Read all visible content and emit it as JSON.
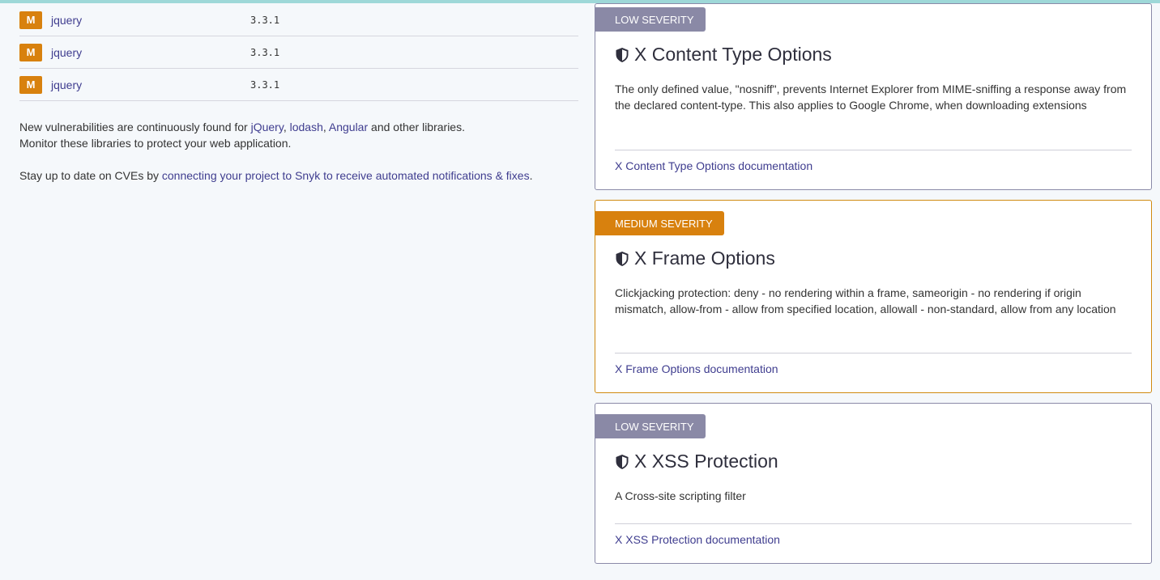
{
  "dependencies": [
    {
      "badge": "M",
      "name": "jquery",
      "version": "3.3.1"
    },
    {
      "badge": "M",
      "name": "jquery",
      "version": "3.3.1"
    },
    {
      "badge": "M",
      "name": "jquery",
      "version": "3.3.1"
    }
  ],
  "info": {
    "line1_prefix": "New vulnerabilities are continuously found for ",
    "link_jquery": "jQuery",
    "sep1": ", ",
    "link_lodash": "lodash",
    "sep2": ", ",
    "link_angular": "Angular",
    "line1_suffix": " and other libraries.",
    "line2": "Monitor these libraries to protect your web application.",
    "line3_prefix": "Stay up to date on CVEs by ",
    "line3_link": "connecting your project to Snyk to receive automated notifications & fixes",
    "line3_suffix": "."
  },
  "headers": [
    {
      "severity": "LOW SEVERITY",
      "title": "X Content Type Options",
      "description": "The only defined value, \"nosniff\", prevents Internet Explorer from MIME-sniffing a response away from the declared content-type. This also applies to Google Chrome, when downloading extensions",
      "doc_link": "X Content Type Options documentation"
    },
    {
      "severity": "MEDIUM SEVERITY",
      "title": "X Frame Options",
      "description": "Clickjacking protection: deny - no rendering within a frame, sameorigin - no rendering if origin mismatch, allow-from - allow from specified location, allowall - non-standard, allow from any location",
      "doc_link": "X Frame Options documentation"
    },
    {
      "severity": "LOW SEVERITY",
      "title": "X XSS Protection",
      "description": "A Cross-site scripting filter",
      "doc_link": "X XSS Protection documentation"
    }
  ],
  "colors": {
    "low_severity": "#8a89a6",
    "medium_severity": "#d8810e",
    "link": "#3f3d8f",
    "badge": "#d8810e"
  },
  "icons": {
    "header_icon": "shield-icon"
  }
}
